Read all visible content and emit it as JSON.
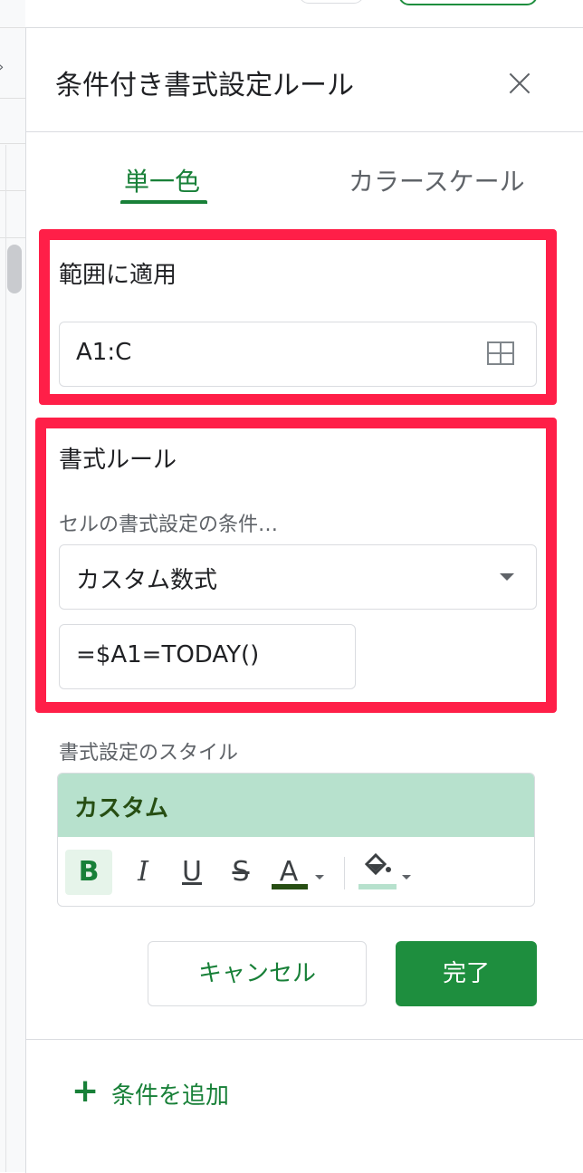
{
  "panel": {
    "title": "条件付き書式設定ルール"
  },
  "tabs": {
    "single_color": "単一色",
    "color_scale": "カラースケール"
  },
  "range": {
    "label": "範囲に適用",
    "value": "A1:C"
  },
  "rules": {
    "label": "書式ルール",
    "condition_label": "セルの書式設定の条件…",
    "condition_value": "カスタム数式",
    "formula_value": "=$A1=TODAY()"
  },
  "style": {
    "label": "書式設定のスタイル",
    "preview_text": "カスタム",
    "bold": "B",
    "italic": "I",
    "underline": "U",
    "strikethrough": "S",
    "text_color_glyph": "A",
    "text_color": "#274e13",
    "fill_color": "#b7e1cd"
  },
  "buttons": {
    "cancel": "キャンセル",
    "done": "完了"
  },
  "add_rule": {
    "label": "条件を追加"
  },
  "colors": {
    "accent": "#188038",
    "highlight": "#ff1f48"
  }
}
